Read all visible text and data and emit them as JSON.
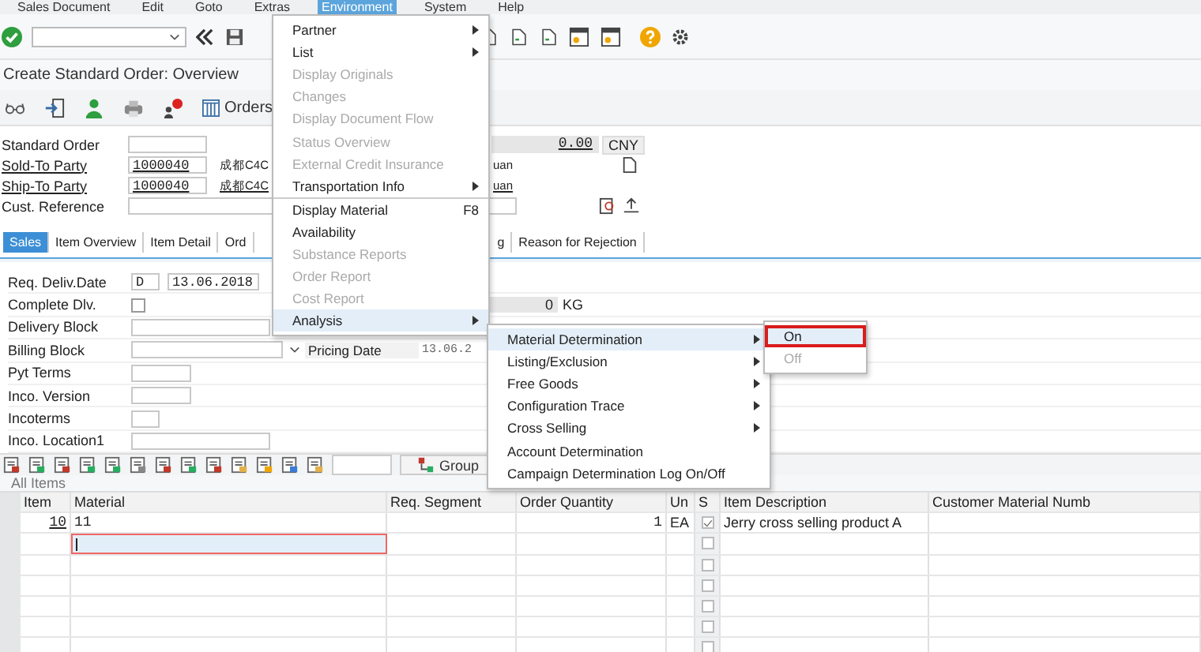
{
  "menu_bar": [
    {
      "label": "Sales Document",
      "selected": false
    },
    {
      "label": "Edit",
      "selected": false
    },
    {
      "label": "Goto",
      "selected": false
    },
    {
      "label": "Extras",
      "selected": false
    },
    {
      "label": "Environment",
      "selected": true
    },
    {
      "label": "System",
      "selected": false
    },
    {
      "label": "Help",
      "selected": false
    }
  ],
  "title": "Create Standard Order: Overview",
  "app_toolbar": {
    "orders_button": "Orders"
  },
  "header_fields": [
    {
      "label": "Standard Order"
    },
    {
      "label": "Sold-To Party",
      "value": "1000040",
      "name_start": "成都C4C",
      "name_end": "uan"
    },
    {
      "label": "Ship-To Party",
      "value": "1000040",
      "name_start": "成都C4C",
      "name_end": "uan"
    },
    {
      "label": "Cust. Reference"
    }
  ],
  "net_value": {
    "amount": "0.00",
    "currency": "CNY"
  },
  "tabs": [
    {
      "label": "Sales",
      "selected": true
    },
    {
      "label": "Item Overview",
      "selected": false
    },
    {
      "label": "Item Detail",
      "selected": false
    },
    {
      "label": "Ord",
      "selected": false
    },
    {
      "label": "g",
      "selected": false
    },
    {
      "label": "Reason for Rejection",
      "selected": false
    }
  ],
  "sales_fields": [
    {
      "label": "Req. Deliv.Date",
      "kind": "date",
      "prefix": "D",
      "value": "13.06.2018"
    },
    {
      "label": "Complete Dlv.",
      "kind": "checkbox",
      "checked": false
    },
    {
      "label": "Delivery Block",
      "kind": "wide"
    },
    {
      "label": "Billing Block",
      "kind": "medium"
    },
    {
      "label": "Pyt Terms",
      "kind": "short"
    },
    {
      "label": "Inco. Version",
      "kind": "short"
    },
    {
      "label": "Incoterms",
      "kind": "tiny"
    },
    {
      "label": "Inco. Location1",
      "kind": "wide"
    }
  ],
  "weight": {
    "value": "0",
    "unit": "KG"
  },
  "pricing_date": {
    "label": "Pricing Date",
    "value": "13.06.2"
  },
  "table_toolbar": {
    "group_button": "Group"
  },
  "items_title": "All Items",
  "table": {
    "columns": [
      "Item",
      "Material",
      "Req. Segment",
      "Order Quantity",
      "Un",
      "S",
      "Item Description",
      "Customer Material Numb"
    ],
    "rows": [
      {
        "item": "10",
        "material": "11",
        "quantity": "1",
        "unit": "EA",
        "checked": true,
        "focused": false,
        "description": "Jerry cross selling product A"
      },
      {
        "checked": false,
        "focused": true
      },
      {
        "checked": false,
        "focused": false
      },
      {
        "checked": false,
        "focused": false
      },
      {
        "checked": false,
        "focused": false
      },
      {
        "checked": false,
        "focused": false
      },
      {
        "checked": false,
        "focused": false
      }
    ]
  },
  "environment_menu": [
    {
      "label": "Partner",
      "disabled": false,
      "submenu": true,
      "selected": false
    },
    {
      "label": "List",
      "disabled": false,
      "submenu": true,
      "selected": false
    },
    {
      "label": "Display Originals",
      "disabled": true,
      "submenu": false,
      "selected": false
    },
    {
      "label": "Changes",
      "disabled": true,
      "submenu": false,
      "selected": false
    },
    {
      "label": "Display Document Flow",
      "disabled": true,
      "submenu": false,
      "selected": false
    },
    {
      "label": "Status Overview",
      "disabled": true,
      "submenu": false,
      "selected": false
    },
    {
      "label": "External Credit Insurance",
      "disabled": true,
      "submenu": false,
      "selected": false
    },
    {
      "label": "Transportation Info",
      "disabled": false,
      "submenu": true,
      "selected": false
    },
    {
      "label": "Display Material",
      "shortcut": "F8",
      "separator": true,
      "disabled": false,
      "submenu": false,
      "selected": false
    },
    {
      "label": "Availability",
      "disabled": false,
      "submenu": false,
      "selected": false
    },
    {
      "label": "Substance Reports",
      "disabled": true,
      "submenu": false,
      "selected": false
    },
    {
      "label": "Order Report",
      "disabled": true,
      "submenu": false,
      "selected": false
    },
    {
      "label": "Cost Report",
      "disabled": true,
      "submenu": false,
      "selected": false
    },
    {
      "label": "Analysis",
      "disabled": false,
      "submenu": true,
      "selected": true
    }
  ],
  "analysis_menu": [
    {
      "label": "Material Determination",
      "disabled": false,
      "submenu": true,
      "selected": true
    },
    {
      "label": "Listing/Exclusion",
      "disabled": false,
      "submenu": true,
      "selected": false
    },
    {
      "label": "Free Goods",
      "disabled": false,
      "submenu": true,
      "selected": false
    },
    {
      "label": "Configuration Trace",
      "disabled": false,
      "submenu": true,
      "selected": false
    },
    {
      "label": "Cross Selling",
      "disabled": false,
      "submenu": true,
      "selected": false
    },
    {
      "label": "Account Determination",
      "disabled": false,
      "submenu": false,
      "selected": false
    },
    {
      "label": "Campaign Determination Log On/Off",
      "disabled": false,
      "submenu": false,
      "selected": false
    }
  ],
  "material_determination_menu": [
    {
      "label": "On",
      "disabled": false,
      "selected": true
    },
    {
      "label": "Off",
      "disabled": true,
      "selected": false
    }
  ]
}
